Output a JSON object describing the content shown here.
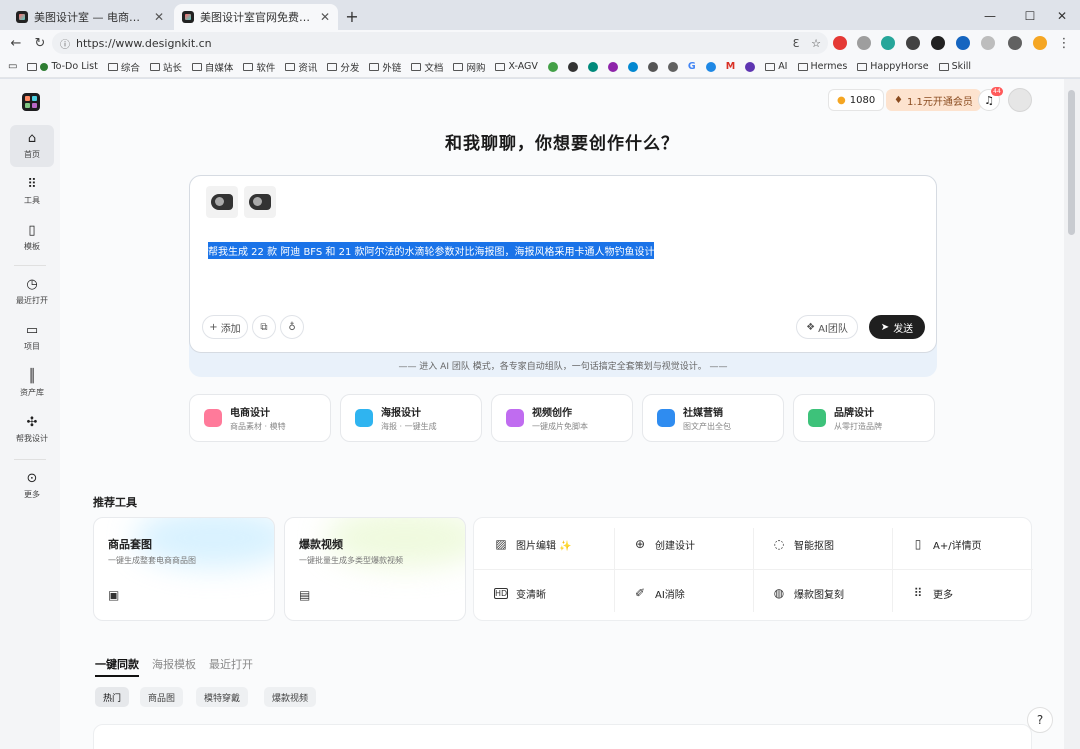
{
  "browser": {
    "tabs": [
      {
        "title": "美图设计室 — 电商人必备的设计…"
      },
      {
        "title": "美图设计室官网免费AI商品图生成…"
      }
    ],
    "new_tab": "+",
    "url": "https://www.designkit.cn",
    "bookmarks": [
      "To-Do List",
      "综合",
      "站长",
      "自媒体",
      "软件",
      "资讯",
      "分发",
      "外链",
      "文档",
      "网购",
      "X-AGV",
      "AI",
      "Hermes",
      "HappyHorse",
      "Skill"
    ]
  },
  "header": {
    "credits": "1080",
    "vip_label": "1.1元开通会员",
    "notif_count": "44"
  },
  "sidebar": {
    "items": [
      {
        "label": "首页",
        "icon": "home-icon"
      },
      {
        "label": "工具",
        "icon": "grid-icon"
      },
      {
        "label": "模板",
        "icon": "template-icon"
      },
      {
        "label": "最近打开",
        "icon": "clock-icon"
      },
      {
        "label": "项目",
        "icon": "folder-icon"
      },
      {
        "label": "资产库",
        "icon": "library-icon"
      },
      {
        "label": "帮我设计",
        "icon": "magic-icon"
      },
      {
        "label": "更多",
        "icon": "more-icon"
      }
    ]
  },
  "main": {
    "headline": "和我聊聊，你想要创作什么？",
    "prompt": "帮我生成 22 款 阿迪 BFS 和 21 款阿尔法的水滴轮参数对比海报图，海报风格采用卡通人物钓鱼设计",
    "add_label": "添加",
    "ai_team_label": "AI团队",
    "send_label": "发送",
    "hint": "—— 进入 AI 团队 模式，各专家自动组队，一句话搞定全套策划与视觉设计。 ——",
    "categories": [
      {
        "title": "电商设计",
        "sub": "商品素材 · 模特",
        "color": "#ff7a9a"
      },
      {
        "title": "海报设计",
        "sub": "海报 · 一键生成",
        "color": "#2fb4f0"
      },
      {
        "title": "视频创作",
        "sub": "一键成片免脚本",
        "color": "#c06cf0"
      },
      {
        "title": "社媒营销",
        "sub": "图文产出全包",
        "color": "#2f8cf0"
      },
      {
        "title": "品牌设计",
        "sub": "从零打造品牌",
        "color": "#3dc27a"
      }
    ],
    "recommended_title": "推荐工具",
    "tool_cards": [
      {
        "title": "商品套图",
        "sub": "一键生成整套电商商品图"
      },
      {
        "title": "爆款视频",
        "sub": "一键批量生成多类型爆款视频"
      }
    ],
    "grid_tools": [
      {
        "label": "图片编辑 ✨",
        "icon": "image-edit-icon"
      },
      {
        "label": "创建设计",
        "icon": "plus-circle-icon"
      },
      {
        "label": "智能抠图",
        "icon": "cutout-icon"
      },
      {
        "label": "A+/详情页",
        "icon": "detail-page-icon"
      },
      {
        "label": "变清晰",
        "icon": "hd-icon"
      },
      {
        "label": "AI消除",
        "icon": "eraser-icon"
      },
      {
        "label": "爆款图复刻",
        "icon": "replicate-icon"
      },
      {
        "label": "更多",
        "icon": "more-grid-icon"
      }
    ],
    "subtabs": [
      "一键同款",
      "海报模板",
      "最近打开"
    ],
    "chips": [
      "热门",
      "商品图",
      "模特穿戴",
      "爆款视频"
    ],
    "help": "?"
  }
}
